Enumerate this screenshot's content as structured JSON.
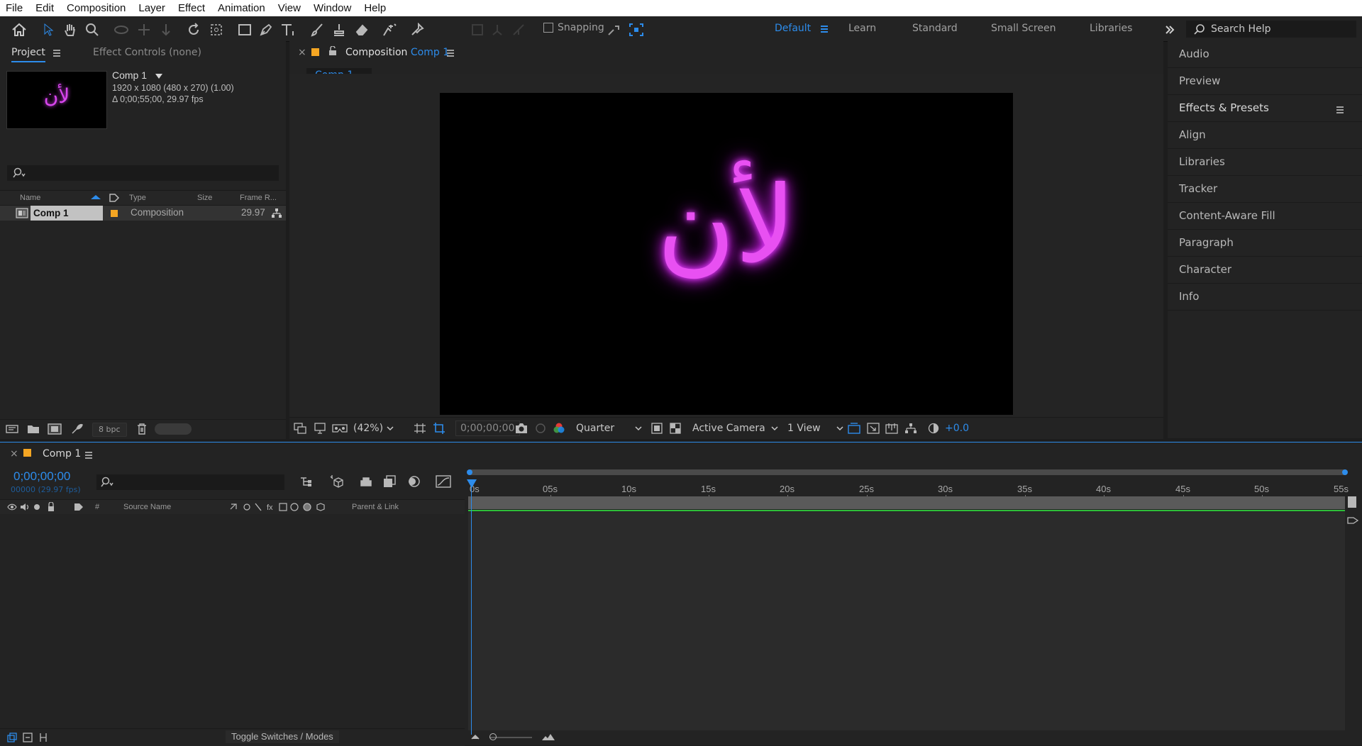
{
  "menu": [
    "File",
    "Edit",
    "Composition",
    "Layer",
    "Effect",
    "Animation",
    "View",
    "Window",
    "Help"
  ],
  "toolbar": {
    "snapping_label": "Snapping",
    "workspaces": [
      "Default",
      "Learn",
      "Standard",
      "Small Screen",
      "Libraries"
    ],
    "active_workspace": "Default",
    "search_placeholder": "Search Help"
  },
  "project": {
    "tab_project": "Project",
    "tab_effect_controls": "Effect Controls (none)",
    "item_name": "Comp 1",
    "info_line1": "1920 x 1080  (480 x 270) (1.00)",
    "info_line2": "Δ 0;00;55;00, 29.97 fps",
    "columns": {
      "name": "Name",
      "type": "Type",
      "size": "Size",
      "frame_rate": "Frame R..."
    },
    "row": {
      "name": "Comp 1",
      "type": "Composition",
      "frame_rate": "29.97"
    },
    "bpc": "8 bpc",
    "label_color": "#f5a623"
  },
  "composition": {
    "tab_prefix": "Composition",
    "tab_name": "Comp 1",
    "breadcrumb": "Comp 1",
    "canvas_text": "لأن",
    "glow_color": "#e040fb",
    "zoom": "(42%)",
    "timecode": "0;00;00;00",
    "resolution": "Quarter",
    "camera": "Active Camera",
    "views": "1 View",
    "exposure": "+0.0"
  },
  "right_panels": [
    "Audio",
    "Preview",
    "Effects & Presets",
    "Align",
    "Libraries",
    "Tracker",
    "Content-Aware Fill",
    "Paragraph",
    "Character",
    "Info"
  ],
  "timeline": {
    "tab_name": "Comp 1",
    "timecode": "0;00;00;00",
    "frame_info": "00000 (29.97 fps)",
    "col_source": "Source Name",
    "col_parent": "Parent & Link",
    "col_num": "#",
    "ruler": [
      "0s",
      "05s",
      "10s",
      "15s",
      "20s",
      "25s",
      "30s",
      "35s",
      "40s",
      "45s",
      "50s",
      "55s"
    ],
    "toggle_label": "Toggle Switches / Modes"
  }
}
